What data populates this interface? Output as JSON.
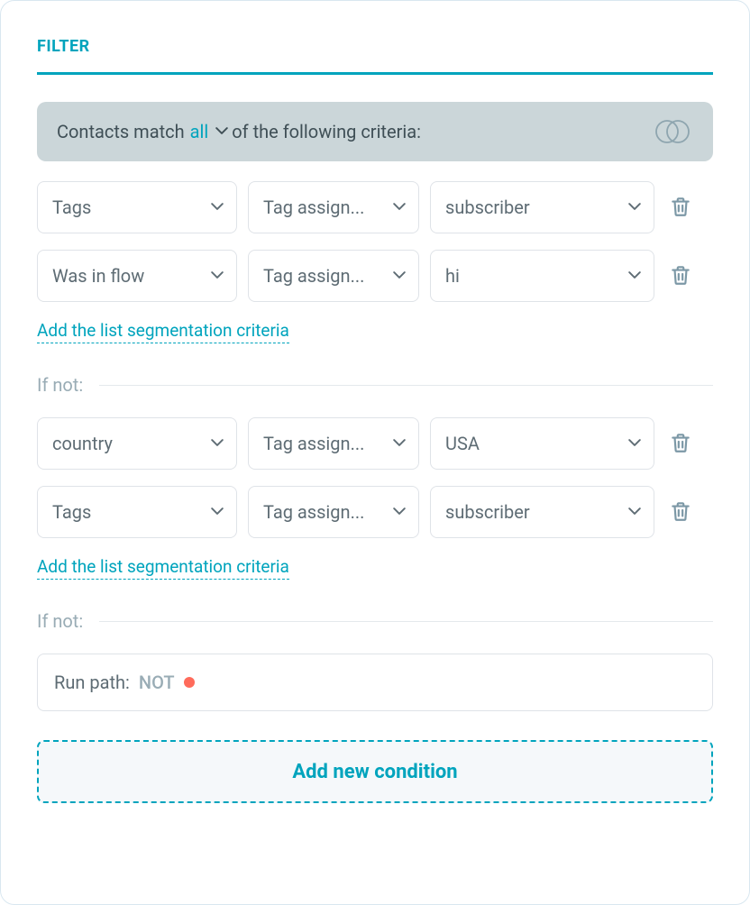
{
  "title": "FILTER",
  "match": {
    "prefix": "Contacts match",
    "mode": "all",
    "suffix": "of the following criteria:"
  },
  "group1": {
    "rows": [
      {
        "field": "Tags",
        "operator": "Tag assign...",
        "value": "subscriber"
      },
      {
        "field": "Was in flow",
        "operator": "Tag assign...",
        "value": "hi"
      }
    ],
    "add_link": "Add the list segmentation criteria"
  },
  "ifnot_label": "If not:",
  "group2": {
    "rows": [
      {
        "field": "country",
        "operator": "Tag assign...",
        "value": "USA"
      },
      {
        "field": "Tags",
        "operator": "Tag assign...",
        "value": "subscriber"
      }
    ],
    "add_link": "Add the list segmentation criteria"
  },
  "runpath": {
    "label": "Run path:",
    "value": "NOT"
  },
  "add_condition": "Add new condition"
}
